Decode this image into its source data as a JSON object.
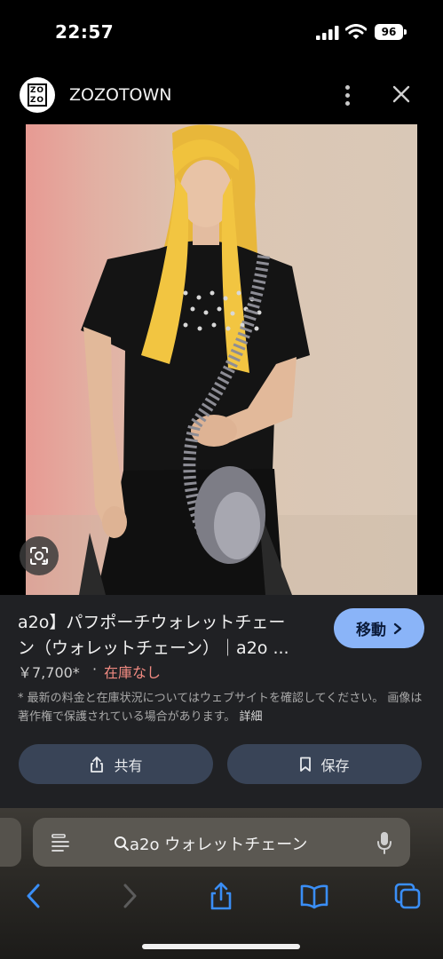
{
  "status_bar": {
    "time": "22:57",
    "battery": "96"
  },
  "header": {
    "site_name": "ZOZOTOWN",
    "logo_text": "ZOZO"
  },
  "result": {
    "title_line1": "a2o】パフポーチウォレットチェー",
    "title_line2": "ン（ウォレットチェーン）｜a2o ...",
    "price": "￥7,700*",
    "separator": "·",
    "stock": "在庫なし",
    "goto_label": "移動",
    "disclaimer": "* 最新の料金と在庫状況についてはウェブサイトを確認してください。 画像は著作権で保護されている場合があります。",
    "details_link": "詳細",
    "share_label": "共有",
    "save_label": "保存"
  },
  "browser": {
    "search_query": "a2o ウォレットチェーン"
  },
  "colors": {
    "accent_button": "#8ab4f8",
    "out_of_stock": "#f28b82",
    "panel_bg": "#202124",
    "pill_bg": "#394457",
    "safari_icon": "#3a8ef6"
  }
}
